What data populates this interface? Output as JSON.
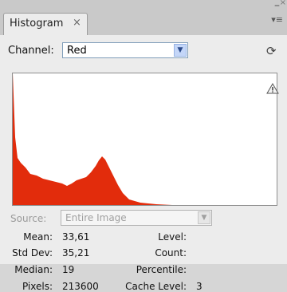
{
  "panel": {
    "tab_title": "Histogram",
    "close_glyph": "×",
    "minimize_glyph": "–",
    "panel_close_glyph": "×",
    "menu_glyph": "▾≡"
  },
  "channel": {
    "label": "Channel:",
    "selected": "Red",
    "dropdown_glyph": "▼",
    "refresh_glyph": "⟳"
  },
  "histogram": {
    "channel_color": "#e22c0c",
    "warning_icon": "warning-triangle"
  },
  "source": {
    "label": "Source:",
    "selected": "Entire Image",
    "dropdown_glyph": "▼"
  },
  "stats": {
    "mean_label": "Mean:",
    "mean_value": "33,61",
    "std_dev_label": "Std Dev:",
    "std_dev_value": "35,21",
    "median_label": "Median:",
    "median_value": "19",
    "pixels_label": "Pixels:",
    "pixels_value": "213600",
    "level_label": "Level:",
    "level_value": "",
    "count_label": "Count:",
    "count_value": "",
    "percentile_label": "Percentile:",
    "percentile_value": "",
    "cache_level_label": "Cache Level:",
    "cache_level_value": "3"
  }
}
